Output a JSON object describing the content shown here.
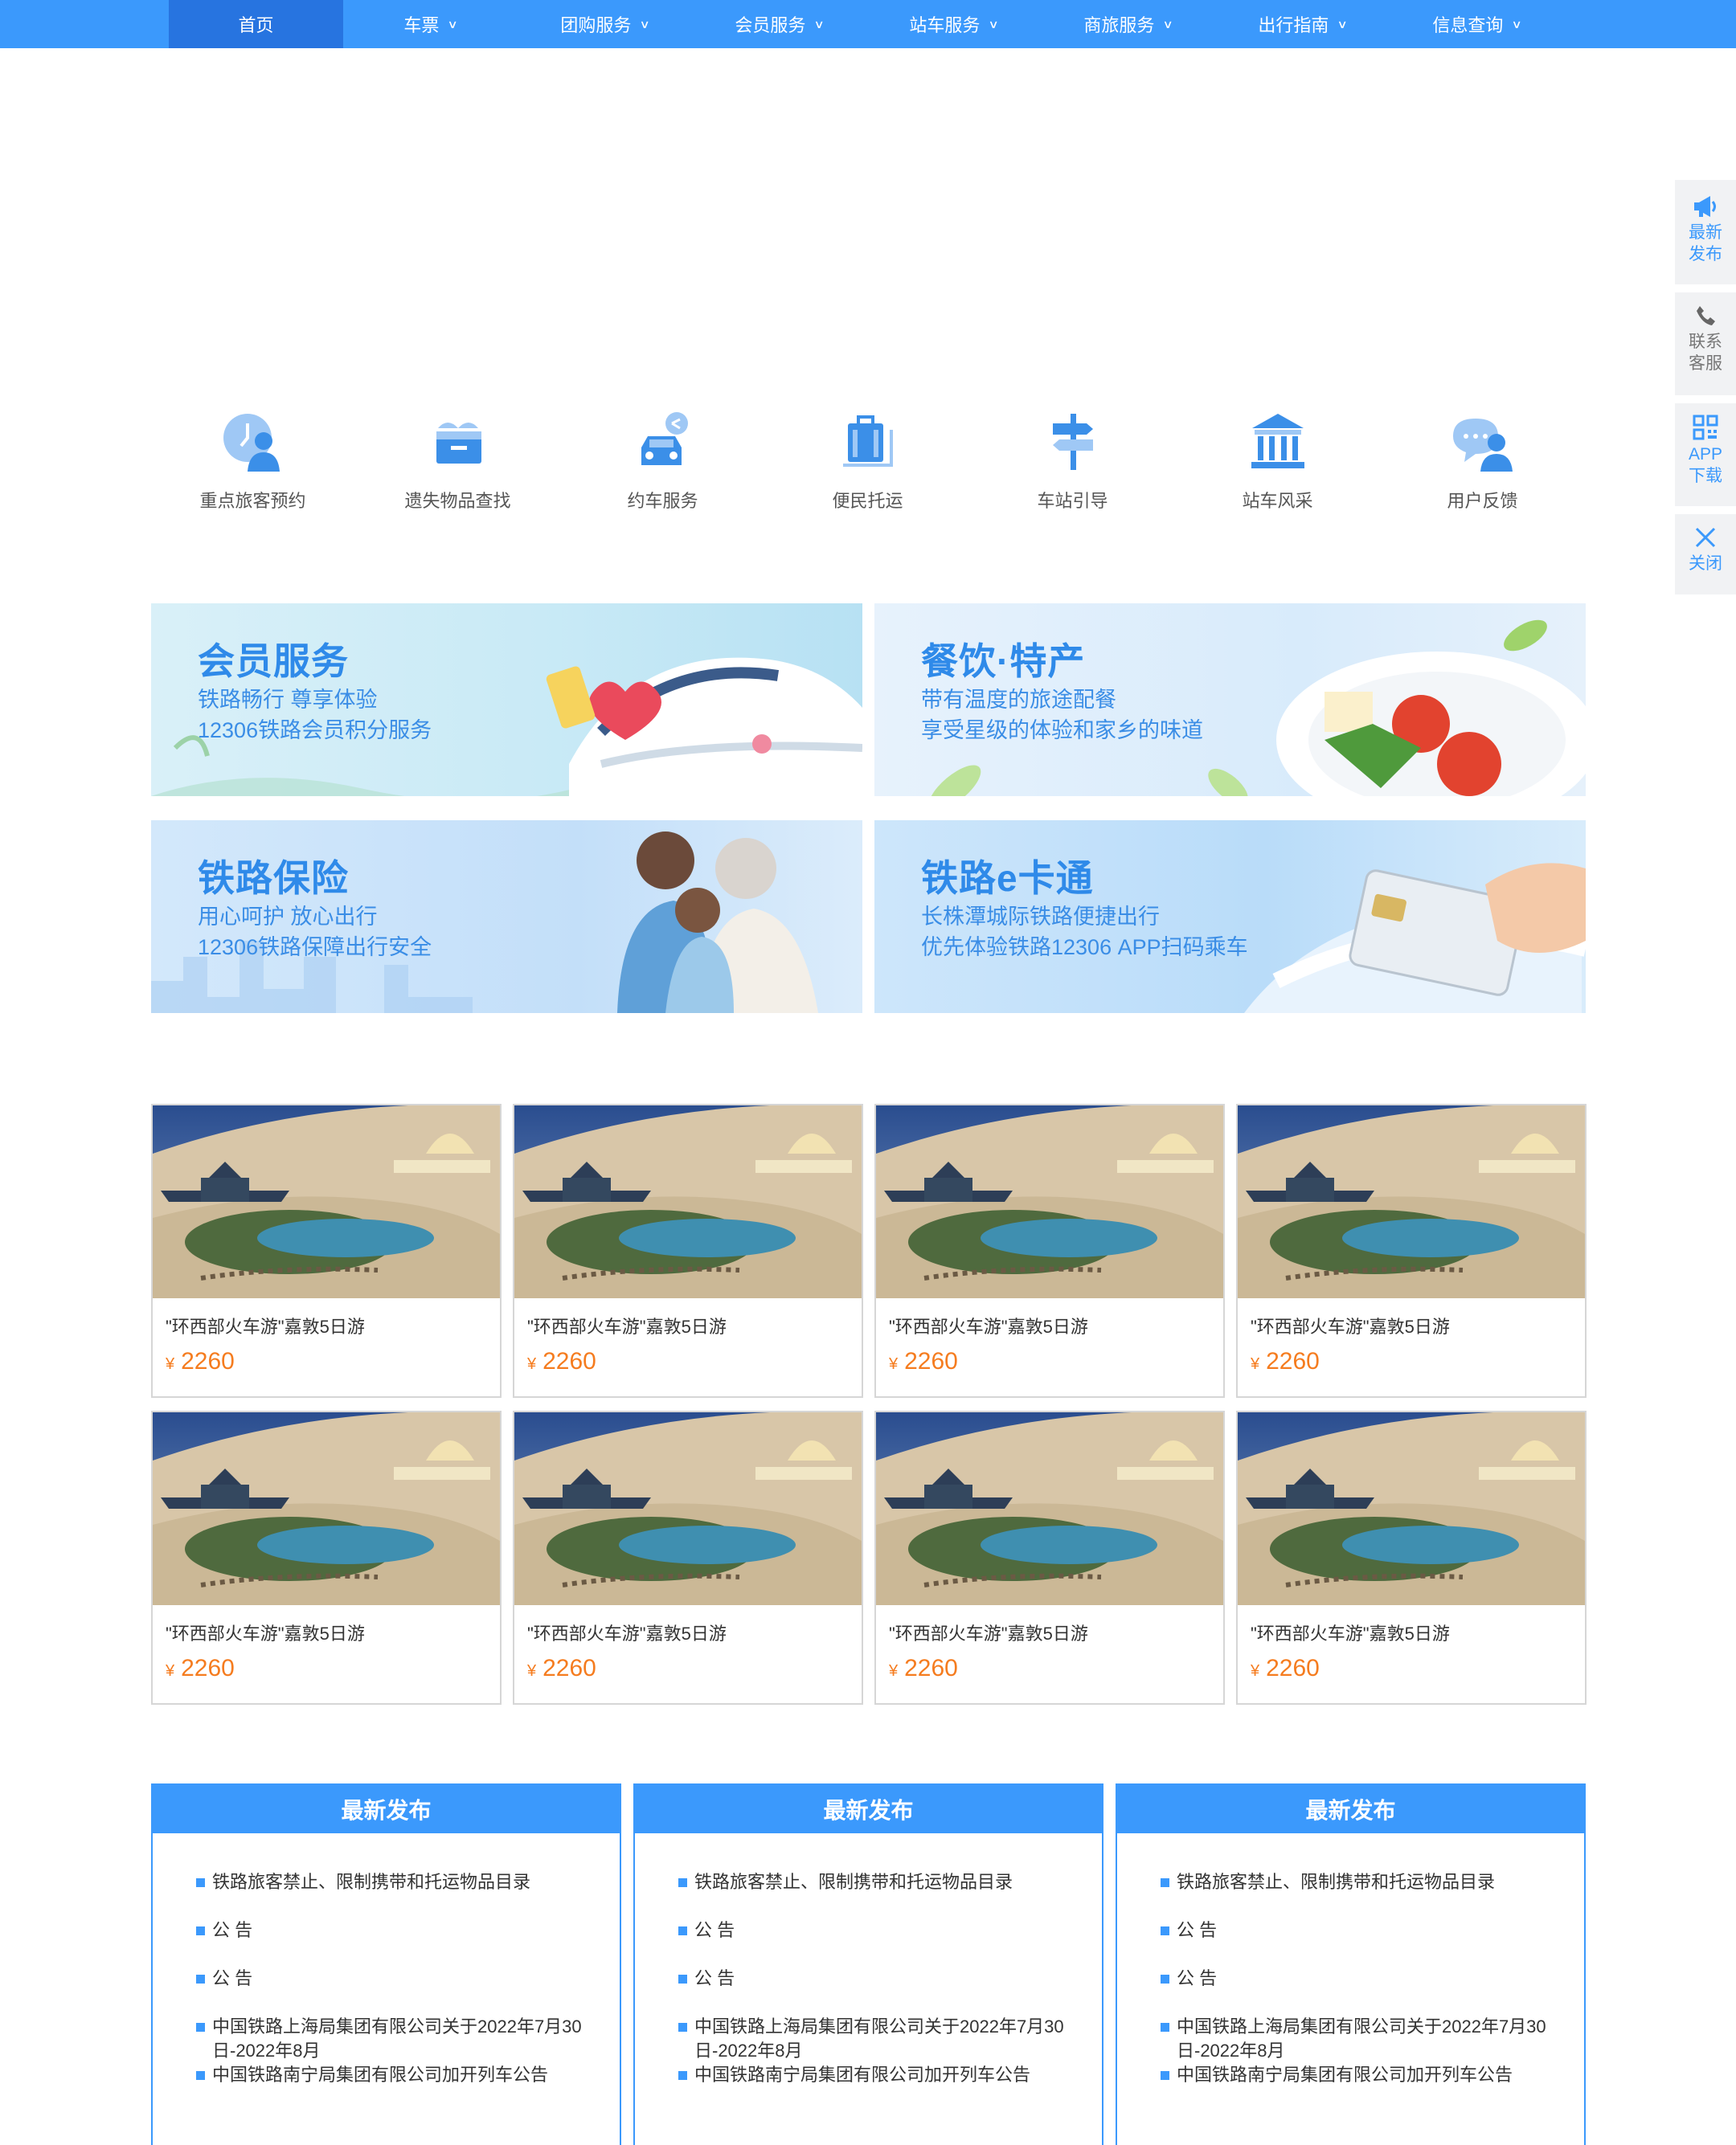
{
  "nav": {
    "items": [
      {
        "label": "首页",
        "has_dropdown": false,
        "active": true
      },
      {
        "label": "车票",
        "has_dropdown": true
      },
      {
        "label": "团购服务",
        "has_dropdown": true
      },
      {
        "label": "会员服务",
        "has_dropdown": true
      },
      {
        "label": "站车服务",
        "has_dropdown": true
      },
      {
        "label": "商旅服务",
        "has_dropdown": true
      },
      {
        "label": "出行指南",
        "has_dropdown": true
      },
      {
        "label": "信息查询",
        "has_dropdown": true
      }
    ]
  },
  "side_float": {
    "latest": [
      "最新",
      "发布"
    ],
    "service": [
      "联系",
      "客服"
    ],
    "app": [
      "APP",
      "下载"
    ],
    "close": "关闭"
  },
  "services": [
    {
      "label": "重点旅客预约",
      "icon": "clock-person-icon"
    },
    {
      "label": "遗失物品查找",
      "icon": "lost-box-icon"
    },
    {
      "label": "约车服务",
      "icon": "car-share-icon"
    },
    {
      "label": "便民托运",
      "icon": "luggage-cart-icon"
    },
    {
      "label": "车站引导",
      "icon": "signpost-icon"
    },
    {
      "label": "站车风采",
      "icon": "building-icon"
    },
    {
      "label": "用户反馈",
      "icon": "chat-person-icon"
    }
  ],
  "banners": [
    {
      "title": "会员服务",
      "lines": [
        "铁路畅行 尊享体验",
        "12306铁路会员积分服务"
      ]
    },
    {
      "title": "餐饮·特产",
      "lines": [
        "带有温度的旅途配餐",
        "享受星级的体验和家乡的味道"
      ]
    },
    {
      "title": "铁路保险",
      "lines": [
        "用心呵护 放心出行",
        "12306铁路保障出行安全"
      ]
    },
    {
      "title": "铁路e卡通",
      "lines": [
        "长株潭城际铁路便捷出行",
        "优先体验铁路12306 APP扫码乘车"
      ]
    }
  ],
  "products": [
    {
      "title": "\"环西部火车游\"嘉敦5日游",
      "currency": "¥",
      "price": "2260"
    },
    {
      "title": "\"环西部火车游\"嘉敦5日游",
      "currency": "¥",
      "price": "2260"
    },
    {
      "title": "\"环西部火车游\"嘉敦5日游",
      "currency": "¥",
      "price": "2260"
    },
    {
      "title": "\"环西部火车游\"嘉敦5日游",
      "currency": "¥",
      "price": "2260"
    },
    {
      "title": "\"环西部火车游\"嘉敦5日游",
      "currency": "¥",
      "price": "2260"
    },
    {
      "title": "\"环西部火车游\"嘉敦5日游",
      "currency": "¥",
      "price": "2260"
    },
    {
      "title": "\"环西部火车游\"嘉敦5日游",
      "currency": "¥",
      "price": "2260"
    },
    {
      "title": "\"环西部火车游\"嘉敦5日游",
      "currency": "¥",
      "price": "2260"
    }
  ],
  "news_panels": [
    {
      "header": "最新发布",
      "items": [
        "铁路旅客禁止、限制携带和托运物品目录",
        "公 告",
        "公 告",
        "中国铁路上海局集团有限公司关于2022年7月30日-2022年8月",
        "中国铁路南宁局集团有限公司加开列车公告"
      ]
    },
    {
      "header": "最新发布",
      "items": [
        "铁路旅客禁止、限制携带和托运物品目录",
        "公 告",
        "公 告",
        "中国铁路上海局集团有限公司关于2022年7月30日-2022年8月",
        "中国铁路南宁局集团有限公司加开列车公告"
      ]
    },
    {
      "header": "最新发布",
      "items": [
        "铁路旅客禁止、限制携带和托运物品目录",
        "公 告",
        "公 告",
        "中国铁路上海局集团有限公司关于2022年7月30日-2022年8月",
        "中国铁路南宁局集团有限公司加开列车公告"
      ]
    }
  ],
  "colors": {
    "accent": "#3b99fc",
    "nav_active": "#2774e0",
    "price": "#f57c1f"
  }
}
